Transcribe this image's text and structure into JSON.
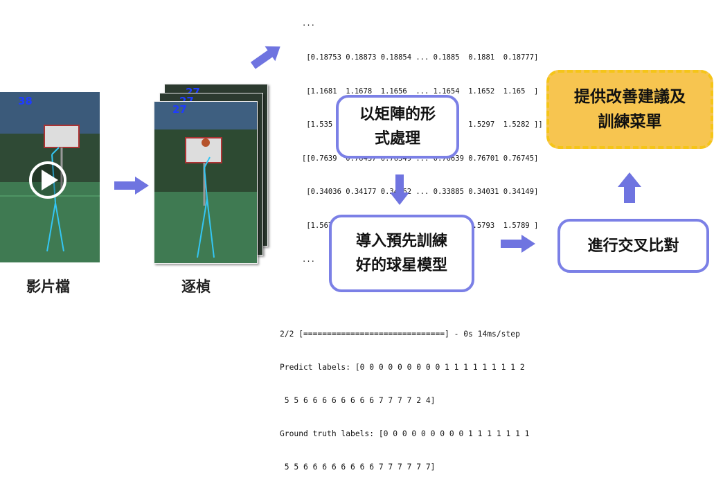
{
  "colors": {
    "accent": "#7b80e6",
    "result_fill": "#f7c550",
    "result_border": "#f5c518",
    "arrow": "#6f74e0"
  },
  "video": {
    "counter": "38",
    "caption": "影片檔"
  },
  "frames": {
    "counters": [
      "27",
      "27",
      "27"
    ],
    "caption": "逐楨"
  },
  "matrix_output": {
    "lines": [
      "...",
      " [0.18753 0.18873 0.18854 ... 0.1885  0.1881  0.18777]",
      " [1.1681  1.1678  1.1656  ... 1.1654  1.1652  1.165  ]",
      " [1.535   1.5321  1.5313  ... 1.5343  1.5297  1.5282 ]]",
      "[[0.7639  0.76437 0.76549 ... 0.76639 0.76701 0.76745]",
      " [0.34036 0.34177 0.34062 ... 0.33885 0.34031 0.34149]",
      " [1.567   1.5657  1.5689  ... 1.5794  1.5793  1.5789 ]",
      "..."
    ]
  },
  "boxes": {
    "matrix": [
      "以矩陣的形",
      "式處理"
    ],
    "model": [
      "導入預先訓練",
      "好的球星模型"
    ],
    "compare": [
      "進行交叉比對"
    ],
    "result": [
      "提供改善建議及",
      "訓練菜單"
    ]
  },
  "predict_output": {
    "lines": [
      "2/2 [==============================] - 0s 14ms/step",
      "Predict labels: [0 0 0 0 0 0 0 0 0 1 1 1 1 1 1 1 1 2",
      " 5 5 6 6 6 6 6 6 6 6 7 7 7 7 2 4]",
      "Ground truth labels: [0 0 0 0 0 0 0 0 0 1 1 1 1 1 1 1",
      " 5 5 6 6 6 6 6 6 6 6 7 7 7 7 7 7]"
    ]
  }
}
